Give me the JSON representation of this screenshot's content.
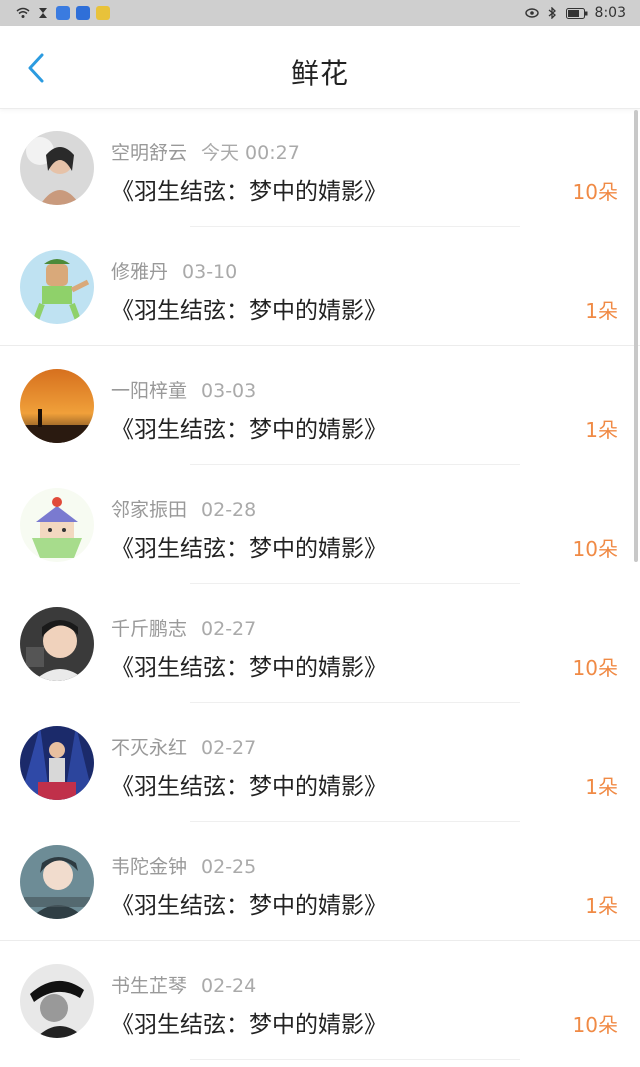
{
  "status_bar": {
    "time": "8:03"
  },
  "header": {
    "title": "鲜花"
  },
  "items": [
    {
      "user": "空明舒云",
      "date": "今天 00:27",
      "book": "《羽生结弦：梦中的婧影》",
      "count": "10朵"
    },
    {
      "user": "修雅丹",
      "date": "03-10",
      "book": "《羽生结弦：梦中的婧影》",
      "count": "1朵"
    },
    {
      "user": "一阳梓童",
      "date": "03-03",
      "book": "《羽生结弦：梦中的婧影》",
      "count": "1朵"
    },
    {
      "user": "邻家振田",
      "date": "02-28",
      "book": "《羽生结弦：梦中的婧影》",
      "count": "10朵"
    },
    {
      "user": "千斤鹏志",
      "date": "02-27",
      "book": "《羽生结弦：梦中的婧影》",
      "count": "10朵"
    },
    {
      "user": "不灭永红",
      "date": "02-27",
      "book": "《羽生结弦：梦中的婧影》",
      "count": "1朵"
    },
    {
      "user": "韦陀金钟",
      "date": "02-25",
      "book": "《羽生结弦：梦中的婧影》",
      "count": "1朵"
    },
    {
      "user": "书生芷琴",
      "date": "02-24",
      "book": "《羽生结弦：梦中的婧影》",
      "count": "10朵"
    }
  ],
  "colors": {
    "accent": "#2b9be0",
    "count": "#f08a45"
  }
}
